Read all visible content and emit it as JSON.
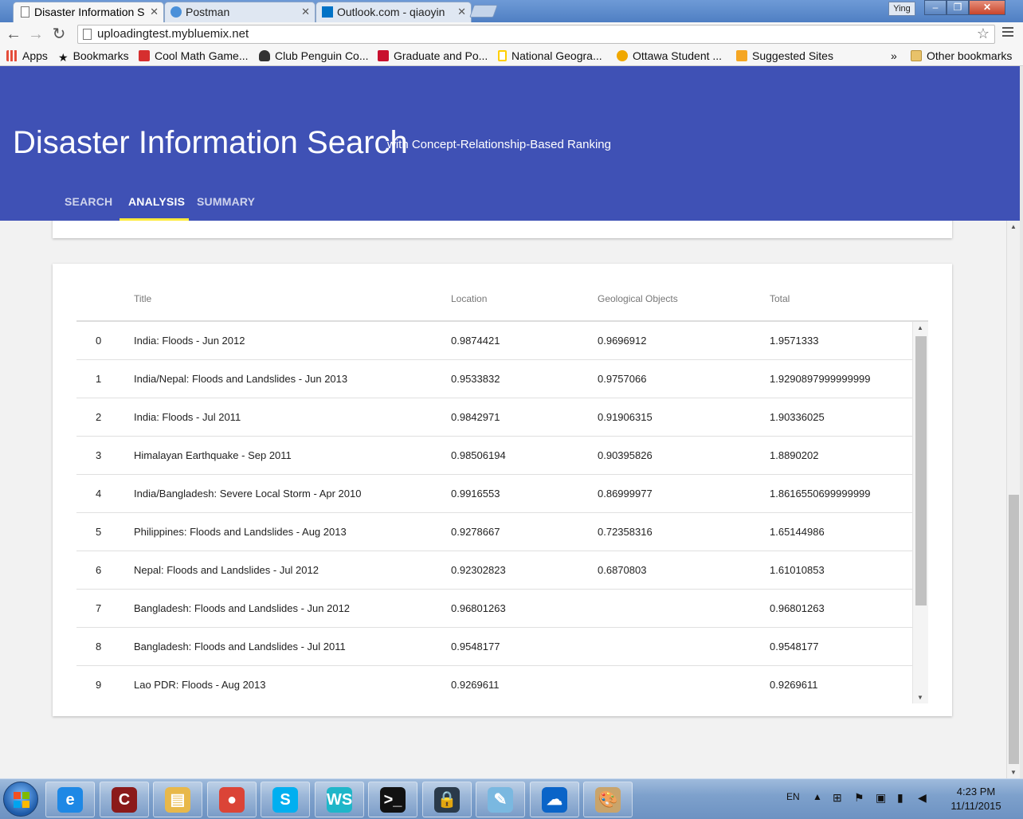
{
  "browser": {
    "tabs": [
      {
        "label": "Disaster Information S",
        "active": true
      },
      {
        "label": "Postman",
        "active": false
      },
      {
        "label": "Outlook.com - qiaoyin",
        "active": false
      }
    ],
    "user_badge": "Ying",
    "window_controls": {
      "minimize": "–",
      "maximize": "❐",
      "close": "✕"
    },
    "url": "uploadingtest.mybluemix.net",
    "bookmarks": [
      {
        "label": "Apps",
        "color": "#e44d3a"
      },
      {
        "label": "Bookmarks",
        "color": "#555555"
      },
      {
        "label": "Cool Math Game...",
        "color": "#d62f2f"
      },
      {
        "label": "Club Penguin Co...",
        "color": "#333333"
      },
      {
        "label": "Graduate and Po...",
        "color": "#c8102e"
      },
      {
        "label": "National Geogra...",
        "color": "#ffce00"
      },
      {
        "label": "Ottawa Student ...",
        "color": "#f0a800"
      },
      {
        "label": "Suggested Sites",
        "color": "#f5a623"
      }
    ],
    "bookmarks_overflow": "»",
    "other_bookmarks": "Other bookmarks"
  },
  "app": {
    "title": "Disaster Information Search",
    "subtitle": "with Concept-Relationship-Based Ranking",
    "accent": "#3f51b5",
    "indicator": "#ffeb3b",
    "tabs": [
      {
        "label": "SEARCH"
      },
      {
        "label": "ANALYSIS"
      },
      {
        "label": "SUMMARY"
      }
    ]
  },
  "table": {
    "columns": [
      "Title",
      "Location",
      "Geological Objects",
      "Total"
    ],
    "rows": [
      {
        "idx": "0",
        "title": "India: Floods - Jun 2012",
        "location": "0.9874421",
        "geo": "0.9696912",
        "total": "1.9571333"
      },
      {
        "idx": "1",
        "title": "India/Nepal: Floods and Landslides - Jun 2013",
        "location": "0.9533832",
        "geo": "0.9757066",
        "total": "1.9290897999999999"
      },
      {
        "idx": "2",
        "title": "India: Floods - Jul 2011",
        "location": "0.9842971",
        "geo": "0.91906315",
        "total": "1.90336025"
      },
      {
        "idx": "3",
        "title": "Himalayan Earthquake - Sep 2011",
        "location": "0.98506194",
        "geo": "0.90395826",
        "total": "1.8890202"
      },
      {
        "idx": "4",
        "title": "India/Bangladesh: Severe Local Storm - Apr 2010",
        "location": "0.9916553",
        "geo": "0.86999977",
        "total": "1.8616550699999999"
      },
      {
        "idx": "5",
        "title": "Philippines: Floods and Landslides - Aug 2013",
        "location": "0.9278667",
        "geo": "0.72358316",
        "total": "1.65144986"
      },
      {
        "idx": "6",
        "title": "Nepal: Floods and Landslides - Jul 2012",
        "location": "0.92302823",
        "geo": "0.6870803",
        "total": "1.61010853"
      },
      {
        "idx": "7",
        "title": "Bangladesh: Floods and Landslides - Jun 2012",
        "location": "0.96801263",
        "geo": "",
        "total": "0.96801263"
      },
      {
        "idx": "8",
        "title": "Bangladesh: Floods and Landslides - Jul 2011",
        "location": "0.9548177",
        "geo": "",
        "total": "0.9548177"
      },
      {
        "idx": "9",
        "title": "Lao PDR: Floods - Aug 2013",
        "location": "0.9269611",
        "geo": "",
        "total": "0.9269611"
      }
    ]
  },
  "taskbar": {
    "apps": [
      {
        "name": "internet-explorer",
        "glyph": "e",
        "color": "#1e88e5"
      },
      {
        "name": "collins-dictionary",
        "glyph": "C",
        "color": "#8b1a1a"
      },
      {
        "name": "file-explorer",
        "glyph": "▤",
        "color": "#e8b84a"
      },
      {
        "name": "chrome",
        "glyph": "●",
        "color": "#db4437"
      },
      {
        "name": "skype",
        "glyph": "S",
        "color": "#00aff0"
      },
      {
        "name": "webstorm",
        "glyph": "WS",
        "color": "#1fb6c9"
      },
      {
        "name": "command-prompt",
        "glyph": ">_",
        "color": "#111111"
      },
      {
        "name": "security-lock",
        "glyph": "🔒",
        "color": "#2a3a4a"
      },
      {
        "name": "notepad",
        "glyph": "✎",
        "color": "#7ab8e0"
      },
      {
        "name": "onedrive",
        "glyph": "☁",
        "color": "#0a64c8"
      },
      {
        "name": "paint",
        "glyph": "🎨",
        "color": "#c9a46b"
      }
    ],
    "language": "EN",
    "time": "4:23 PM",
    "date": "11/11/2015"
  }
}
